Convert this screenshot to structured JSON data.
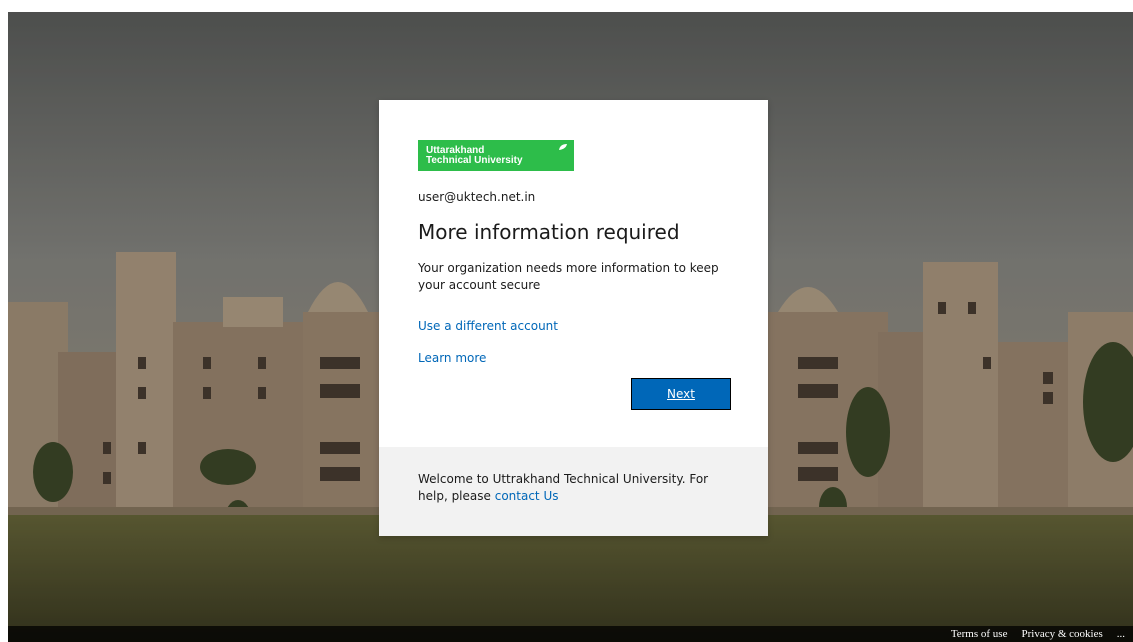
{
  "logo": {
    "line1": "Uttarakhand",
    "line2": "Technical University"
  },
  "signin": {
    "email": "user@uktech.net.in",
    "title": "More information required",
    "description": "Your organization needs more information to keep your account secure",
    "use_different_account": "Use a different account",
    "learn_more": "Learn more",
    "next_label": "Next"
  },
  "footer": {
    "welcome_text": "Welcome to Uttrakhand Technical University. For help, please",
    "contact_link": "contact Us"
  },
  "bottom_bar": {
    "terms": "Terms of use",
    "privacy": "Privacy & cookies",
    "more": "..."
  },
  "colors": {
    "accent": "#0067b8",
    "logo_green": "#2dbd4a",
    "footer_bg": "#f2f2f2"
  }
}
